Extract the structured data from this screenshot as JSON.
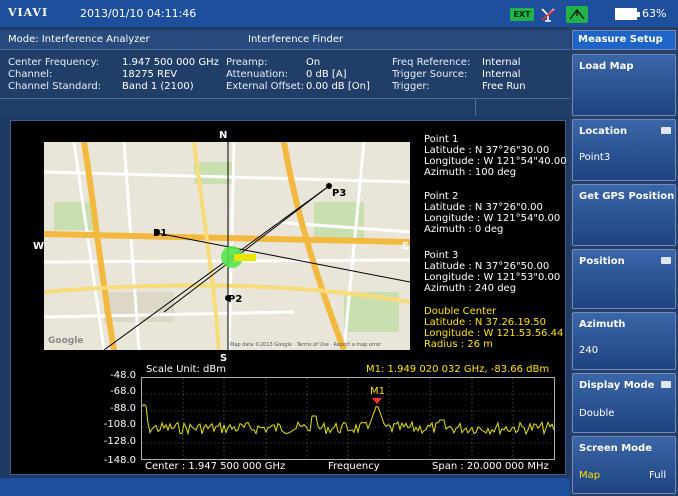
{
  "status_bar": {
    "logo": "VIAVI",
    "datetime": "2013/01/10 04:11:46",
    "ext_badge": "EXT",
    "battery": "63%"
  },
  "mode_row": {
    "mode": "Mode: Interference Analyzer",
    "function": "Interference Finder"
  },
  "params": {
    "center_frequency_label": "Center Frequency:",
    "center_frequency": "1.947 500 000 GHz",
    "channel_label": "Channel:",
    "channel": "18275 REV",
    "channel_standard_label": "Channel Standard:",
    "channel_standard": "Band 1 (2100)",
    "preamp_label": "Preamp:",
    "preamp": "On",
    "attenuation_label": "Attenuation:",
    "attenuation": "0 dB  [A]",
    "external_offset_label": "External Offset:",
    "external_offset": "0.00 dB  [On]",
    "freq_reference_label": "Freq Reference:",
    "freq_reference": "Internal",
    "trigger_source_label": "Trigger Source:",
    "trigger_source": "Internal",
    "trigger_label": "Trigger:",
    "trigger": "Free Run"
  },
  "map": {
    "compass_n": "N",
    "compass_s": "S",
    "compass_w": "W",
    "compass_e": "E",
    "p1": "P1",
    "p2": "P2",
    "p3": "P3",
    "google": "Google",
    "footer": "Map data ©2013 Google · Terms of Use · Report a map error"
  },
  "points": {
    "point1": "Point 1\nLatitude : N 37°26\"30.00\nLongitude : W 121°54\"40.00\nAzimuth : 100 deg",
    "point2": "Point 2\nLatitude : N 37°26\"0.00\nLongitude : W 121°54\"0.00\nAzimuth : 0 deg",
    "point3": "Point 3\nLatitude : N 37°26\"50.00\nLongitude : W 121°53\"0.00\nAzimuth : 240 deg",
    "double_center": "Double Center\nLatitude : N 37.26.19.50\nLongitude : W 121.53.56.44\nRadius : 26 m"
  },
  "spectrum": {
    "scale_unit": "Scale Unit: dBm",
    "marker_readout": "M1: 1.949 020 032 GHz, -83.66 dBm",
    "marker_label": "M1",
    "y_ticks": [
      "-48.0",
      "-68.0",
      "-88.0",
      "-108.0",
      "-128.0",
      "-148.0"
    ],
    "center": "Center : 1.947 500 000 GHz",
    "axis_label": "Frequency",
    "span": "Span : 20.000 000 MHz",
    "trace_color": "#e8e000",
    "marker_color": "#ff3030"
  },
  "softkeys": {
    "header": "Measure Setup",
    "load_map": "Load Map",
    "location": "Location",
    "location_value": "Point3",
    "get_gps_position": "Get GPS Position",
    "position": "Position",
    "azimuth": "Azimuth",
    "azimuth_value": "240",
    "display_mode": "Display Mode",
    "display_mode_value": "Double",
    "screen_mode": "Screen Mode",
    "screen_mode_map": "Map",
    "screen_mode_full": "Full",
    "selected_color": "#ffe100"
  }
}
